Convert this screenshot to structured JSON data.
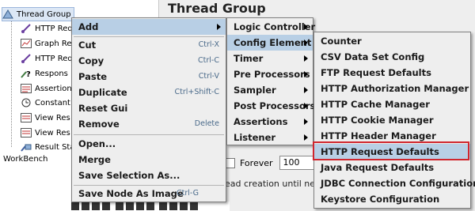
{
  "tree": {
    "root": "Thread Group",
    "items": [
      "HTTP Req",
      "Graph Re",
      "HTTP Req",
      "Respons",
      "Assertion",
      "Constant",
      "View Res",
      "View Res",
      "Result Sta"
    ],
    "workbench": "WorkBench"
  },
  "right_panel": {
    "title": "Thread Group",
    "forever_label": "Forever",
    "loop_value": "100",
    "creation_text": "ead creation until ne"
  },
  "context_menu": {
    "items": [
      {
        "label": "Add",
        "shortcut": ""
      },
      {
        "label": "Cut",
        "shortcut": "Ctrl-X"
      },
      {
        "label": "Copy",
        "shortcut": "Ctrl-C"
      },
      {
        "label": "Paste",
        "shortcut": "Ctrl-V"
      },
      {
        "label": "Duplicate",
        "shortcut": "Ctrl+Shift-C"
      },
      {
        "label": "Reset Gui",
        "shortcut": ""
      },
      {
        "label": "Remove",
        "shortcut": "Delete"
      },
      {
        "label": "Open...",
        "shortcut": ""
      },
      {
        "label": "Merge",
        "shortcut": ""
      },
      {
        "label": "Save Selection As...",
        "shortcut": ""
      },
      {
        "label": "Save Node As Image",
        "shortcut": "Ctrl-G"
      }
    ]
  },
  "add_submenu": {
    "items": [
      "Logic Controller",
      "Config Element",
      "Timer",
      "Pre Processors",
      "Sampler",
      "Post Processors",
      "Assertions",
      "Listener"
    ]
  },
  "config_submenu": {
    "items": [
      "Counter",
      "CSV Data Set Config",
      "FTP Request Defaults",
      "HTTP Authorization Manager",
      "HTTP Cache Manager",
      "HTTP Cookie Manager",
      "HTTP Header Manager",
      "HTTP Request Defaults",
      "Java Request Defaults",
      "JDBC Connection Configuration",
      "Keystore Configuration"
    ],
    "highlighted": "HTTP Request Defaults"
  },
  "colors": {
    "menu_bg": "#eeeeee",
    "highlight": "#b8cfe5",
    "annotation_box": "#d0262e"
  }
}
